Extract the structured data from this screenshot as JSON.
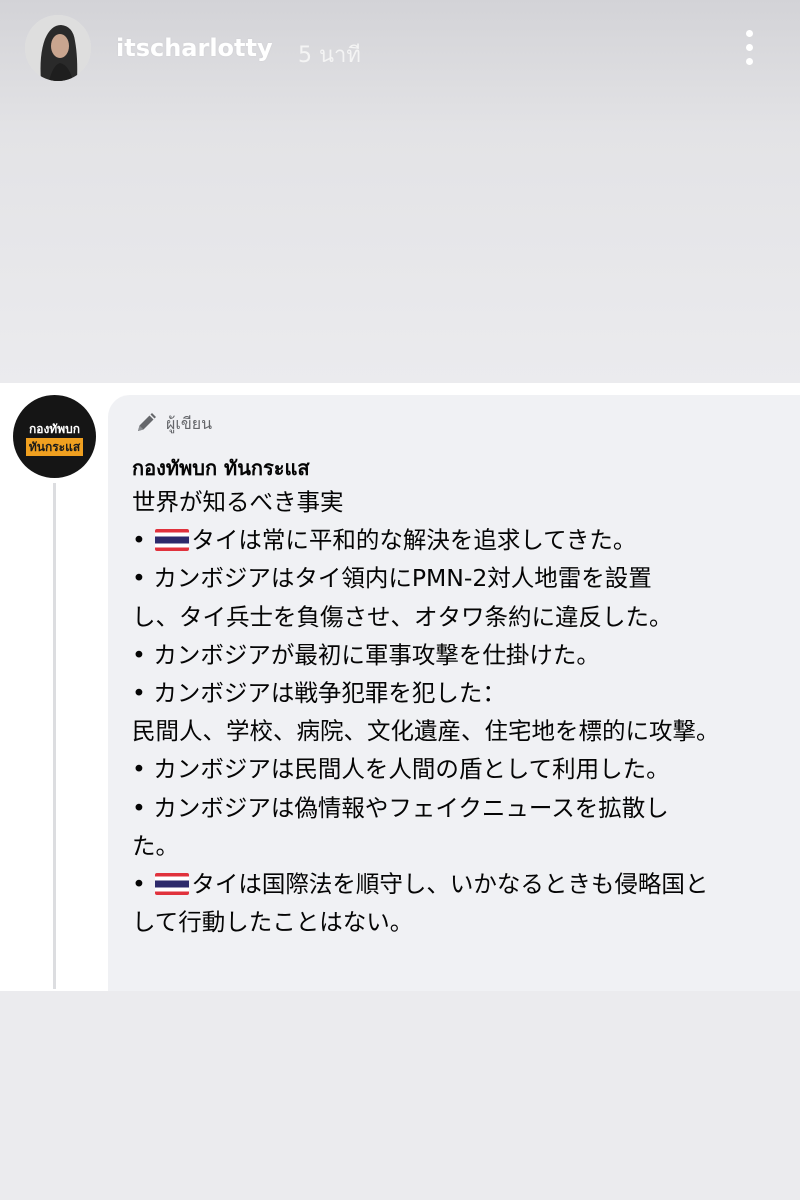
{
  "story": {
    "username": "itscharlotty",
    "time_ago": "5 นาที"
  },
  "post": {
    "page_avatar": {
      "line1": "กองทัพบก",
      "line2": "ทันกระแส"
    },
    "author_badge": "ผู้เขียน",
    "page_name": "กองทัพบก ทันกระแส",
    "lines": [
      {
        "text": "世界が知るべき事実"
      },
      {
        "prefix": "• ",
        "flag": true,
        "text": "タイは常に平和的な解決を追求してきた。"
      },
      {
        "prefix": "• ",
        "text": "カンボジアはタイ領内にPMN-2対人地雷を設置"
      },
      {
        "text": "し、タイ兵士を負傷させ、オタワ条約に違反した。"
      },
      {
        "prefix": "• ",
        "text": "カンボジアが最初に軍事攻撃を仕掛けた。"
      },
      {
        "prefix": "• ",
        "text": "カンボジアは戦争犯罪を犯した："
      },
      {
        "text": "民間人、学校、病院、文化遺産、住宅地を標的に攻撃。"
      },
      {
        "prefix": "• ",
        "text": "カンボジアは民間人を人間の盾として利用した。"
      },
      {
        "prefix": "• ",
        "text": "カンボジアは偽情報やフェイクニュースを拡散し"
      },
      {
        "text": "た。"
      },
      {
        "prefix": "• ",
        "flag": true,
        "text": "タイは国際法を順守し、いかなるときも侵略国と"
      },
      {
        "text": "して行動したことはない。"
      }
    ]
  },
  "icons": {
    "more": "more-vertical-icon",
    "pencil": "pencil-icon",
    "flag": "thailand-flag-icon"
  },
  "colors": {
    "flag_red": "#e0323c",
    "flag_blue": "#2d2a6b",
    "bubble_bg": "#f0f1f4",
    "meta_text": "#65676b"
  }
}
